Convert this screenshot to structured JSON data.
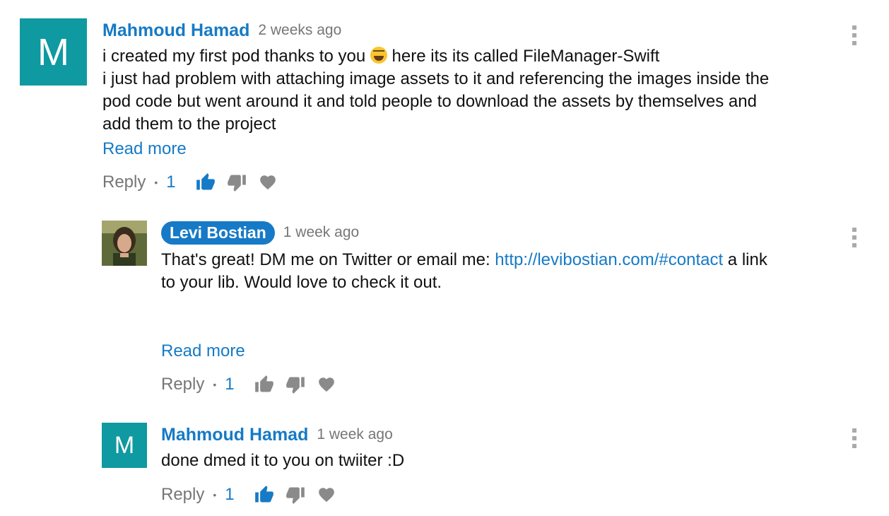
{
  "colors": {
    "accent": "#167ac6",
    "avatar_bg": "#0f99a1",
    "muted": "#767676"
  },
  "comments": [
    {
      "avatar_letter": "M",
      "author": "Mahmoud Hamad",
      "time": "2 weeks ago",
      "lines": [
        "i created my first pod thanks to you",
        "here its its called FileManager-Swift",
        "i just had problem with attaching image assets to it and referencing the images inside the",
        "pod code but went around it and told people to download the assets by themselves and",
        "add them to the project"
      ],
      "emoji": "laughing-emoji",
      "read_more": "Read more",
      "reply": "Reply",
      "like_count": "1",
      "like_active": true
    },
    {
      "avatar_image": "profile-photo",
      "author": "Levi Bostian",
      "time": "1 week ago",
      "text_before_link": "That's great! DM me on Twitter or email me: ",
      "link": "http://levibostian.com/#contact",
      "text_after_link": " a link",
      "text_line2": "to your lib. Would love to check it out.",
      "read_more": "Read more",
      "reply": "Reply",
      "like_count": "1",
      "like_active": false
    },
    {
      "avatar_letter": "M",
      "author": "Mahmoud Hamad",
      "time": "1 week ago",
      "text": "done dmed it to you on twiiter :D",
      "reply": "Reply",
      "like_count": "1",
      "like_active": true
    }
  ]
}
